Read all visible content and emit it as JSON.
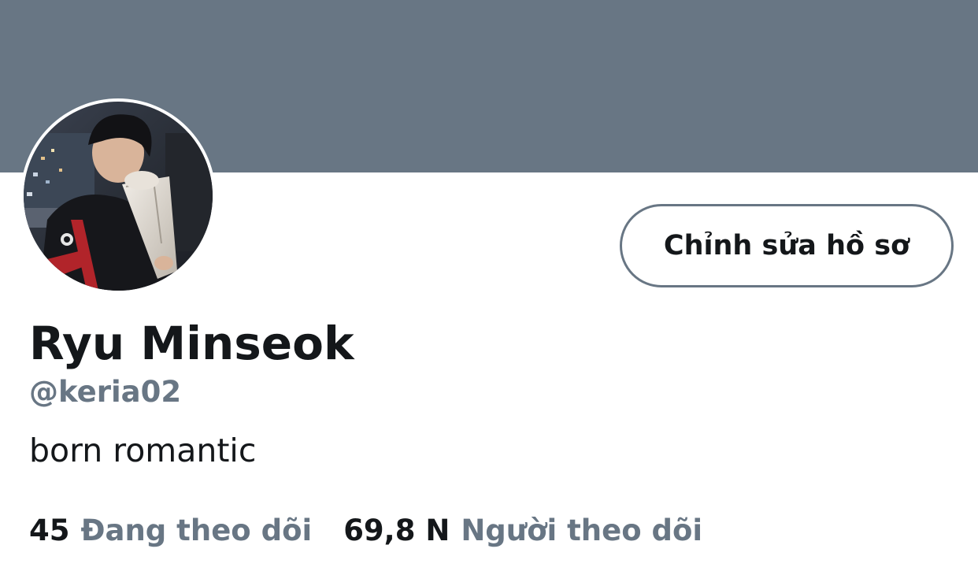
{
  "profile": {
    "display_name": "Ryu Minseok",
    "handle": "@keria02",
    "bio": "born romantic",
    "edit_button_label": "Chỉnh sửa hồ sơ"
  },
  "stats": {
    "following_count": "45",
    "following_label": "Đang theo dõi",
    "followers_count": "69,8 N",
    "followers_label": "Người theo dõi"
  },
  "colors": {
    "banner": "#687684",
    "secondary_text": "#687684",
    "primary_text": "#14171a",
    "button_border": "#687684"
  }
}
